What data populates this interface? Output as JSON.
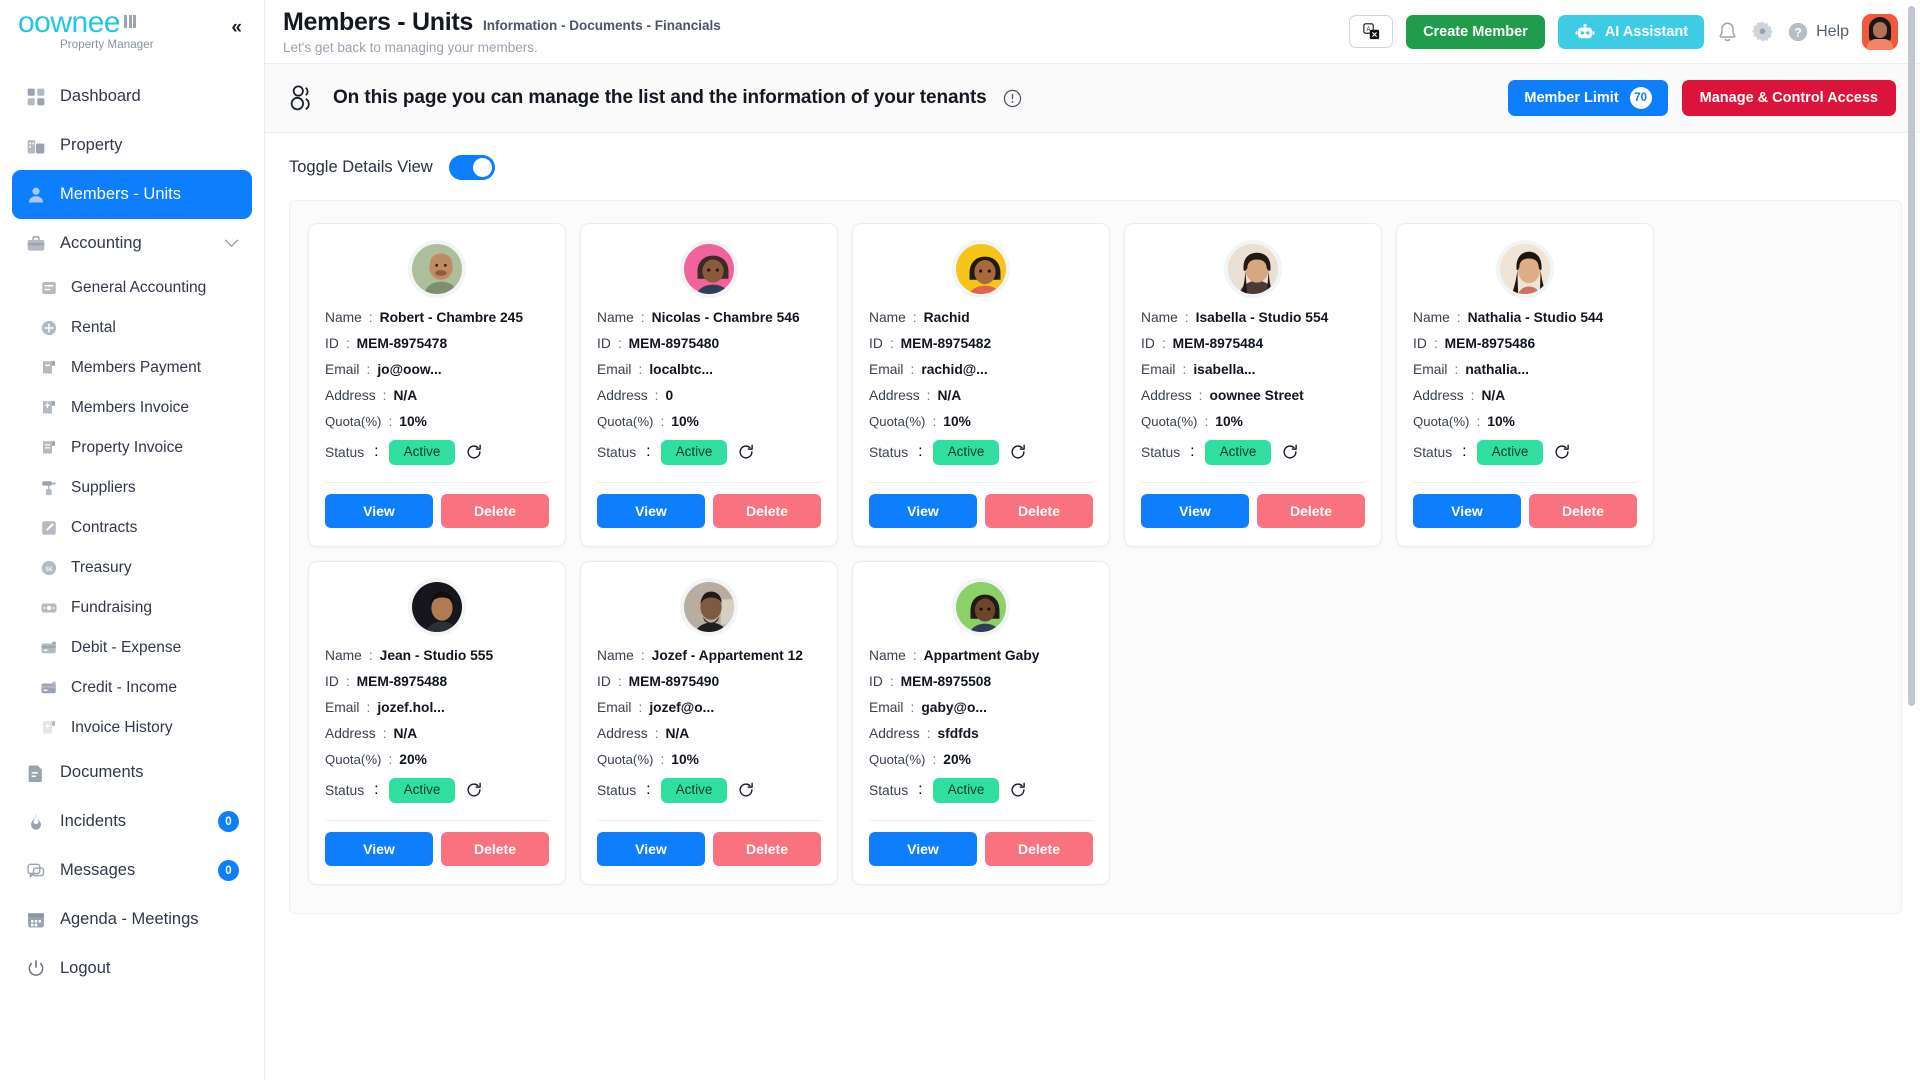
{
  "sidebar": {
    "brand": {
      "name": "oownee",
      "subtitle": "Property Manager"
    },
    "collapse_icon": "chevron-double-left-icon",
    "items": [
      {
        "label": "Dashboard",
        "icon": "grid-icon",
        "active": false,
        "sub": false
      },
      {
        "label": "Property",
        "icon": "building-icon",
        "active": false,
        "sub": false
      },
      {
        "label": "Members - Units",
        "icon": "user-icon",
        "active": true,
        "sub": false
      },
      {
        "label": "Accounting",
        "icon": "briefcase-icon",
        "active": false,
        "sub": false,
        "chevron": true
      },
      {
        "label": "General Accounting",
        "icon": "book-icon",
        "active": false,
        "sub": true
      },
      {
        "label": "Rental",
        "icon": "circle-plus-icon",
        "active": false,
        "sub": true
      },
      {
        "label": "Members Payment",
        "icon": "receipt-minus-icon",
        "active": false,
        "sub": true
      },
      {
        "label": "Members Invoice",
        "icon": "receipt-plus-icon",
        "active": false,
        "sub": true
      },
      {
        "label": "Property Invoice",
        "icon": "receipt-icon",
        "active": false,
        "sub": true
      },
      {
        "label": "Suppliers",
        "icon": "paint-roller-icon",
        "active": false,
        "sub": true
      },
      {
        "label": "Contracts",
        "icon": "pencil-square-icon",
        "active": false,
        "sub": true
      },
      {
        "label": "Treasury",
        "icon": "coin-icon",
        "active": false,
        "sub": true
      },
      {
        "label": "Fundraising",
        "icon": "money-icon",
        "active": false,
        "sub": true
      },
      {
        "label": "Debit - Expense",
        "icon": "card-out-icon",
        "active": false,
        "sub": true
      },
      {
        "label": "Credit - Income",
        "icon": "card-in-icon",
        "active": false,
        "sub": true
      },
      {
        "label": "Invoice History",
        "icon": "receipt-history-icon",
        "active": false,
        "sub": true
      },
      {
        "label": "Documents",
        "icon": "document-icon",
        "active": false,
        "sub": false
      },
      {
        "label": "Incidents",
        "icon": "flame-icon",
        "active": false,
        "sub": false,
        "badge": "0"
      },
      {
        "label": "Messages",
        "icon": "chat-icon",
        "active": false,
        "sub": false,
        "badge": "0"
      },
      {
        "label": "Agenda - Meetings",
        "icon": "calendar-icon",
        "active": false,
        "sub": false
      },
      {
        "label": "Logout",
        "icon": "power-icon",
        "active": false,
        "sub": false
      }
    ]
  },
  "topbar": {
    "title": "Members - Units",
    "subtitle_inline": "Information - Documents - Financials",
    "tagline": "Let's get back to managing your members.",
    "translate_icon": "translate-icon",
    "create_member_label": "Create Member",
    "ai_assistant_label": "AI Assistant",
    "ai_icon": "robot-icon",
    "bell_icon": "bell-icon",
    "gear_icon": "gear-icon",
    "help_icon": "question-circle-icon",
    "help_label": "Help",
    "avatar": "user-avatar"
  },
  "banner": {
    "icon": "people-icon",
    "text": "On this page you can manage the list and the information of your tenants",
    "info_icon": "info-circle-icon",
    "member_limit_label": "Member Limit",
    "member_limit_count": "70",
    "manage_access_label": "Manage & Control Access"
  },
  "toggle": {
    "label": "Toggle Details View",
    "enabled": true
  },
  "card_labels": {
    "name": "Name",
    "id": "ID",
    "email": "Email",
    "address": "Address",
    "quota": "Quota(%)",
    "status": "Status",
    "separator": ":",
    "view": "View",
    "delete": "Delete",
    "refresh_icon": "refresh-icon"
  },
  "colors": {
    "accent_blue": "#0d7efd",
    "green": "#1f9d4d",
    "ai_cyan": "#3ccce4",
    "red": "#dc143c",
    "delete_red": "#f8737f",
    "active_green": "#2fdfa0",
    "brand_cyan": "#21c7e0"
  },
  "members": [
    {
      "name": "Robert - Chambre 245",
      "id": "MEM-8975478",
      "email": "jo@oow...",
      "address": "N/A",
      "quota": "10%",
      "status": "Active",
      "avatar_bg": "#aebd9b",
      "avatar_kind": "bald-man"
    },
    {
      "name": "Nicolas - Chambre 546",
      "id": "MEM-8975480",
      "email": "localbtc...",
      "address": "0",
      "quota": "10%",
      "status": "Active",
      "avatar_bg": "#f0649b",
      "avatar_kind": "woman-pink"
    },
    {
      "name": "Rachid",
      "id": "MEM-8975482",
      "email": "rachid@...",
      "address": "N/A",
      "quota": "10%",
      "status": "Active",
      "avatar_bg": "#f5c518",
      "avatar_kind": "woman-yellow"
    },
    {
      "name": "Isabella - Studio 554",
      "id": "MEM-8975484",
      "email": "isabella...",
      "address": "oownee Street",
      "quota": "10%",
      "status": "Active",
      "avatar_bg": "#d8c0a8",
      "avatar_kind": "photo-woman-1"
    },
    {
      "name": "Nathalia - Studio 544",
      "id": "MEM-8975486",
      "email": "nathalia...",
      "address": "N/A",
      "quota": "10%",
      "status": "Active",
      "avatar_bg": "#e8d2bd",
      "avatar_kind": "photo-woman-2"
    },
    {
      "name": "Jean - Studio 555",
      "id": "MEM-8975488",
      "email": "jozef.hol...",
      "address": "N/A",
      "quota": "20%",
      "status": "Active",
      "avatar_bg": "#1d1f24",
      "avatar_kind": "photo-man-dark"
    },
    {
      "name": "Jozef - Appartement 12",
      "id": "MEM-8975490",
      "email": "jozef@o...",
      "address": "N/A",
      "quota": "10%",
      "status": "Active",
      "avatar_bg": "#9a8f86",
      "avatar_kind": "photo-man-grey"
    },
    {
      "name": "Appartment Gaby",
      "id": "MEM-8975508",
      "email": "gaby@o...",
      "address": "sfdfds",
      "quota": "20%",
      "status": "Active",
      "avatar_bg": "#8cd06a",
      "avatar_kind": "woman-green"
    }
  ]
}
